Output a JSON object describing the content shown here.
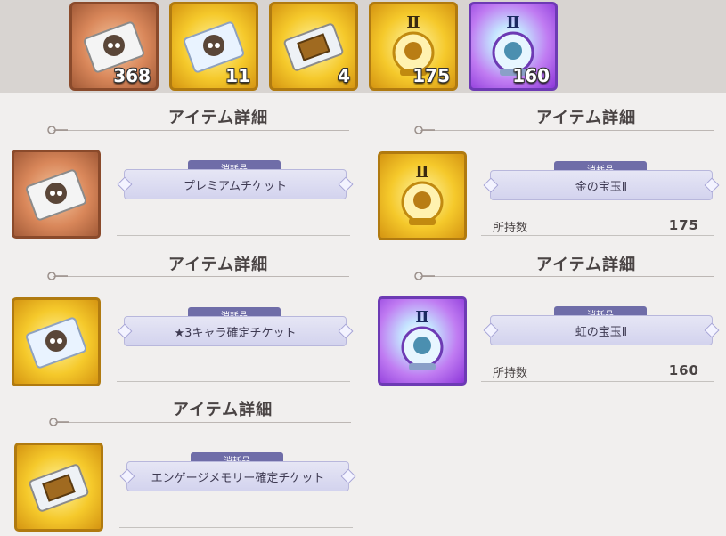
{
  "inventory": [
    {
      "icon": "premium-ticket-icon",
      "count": "368"
    },
    {
      "icon": "star3-ticket-icon",
      "count": "11"
    },
    {
      "icon": "engage-memory-ticket-icon",
      "count": "4"
    },
    {
      "icon": "gold-orb-icon",
      "count": "175"
    },
    {
      "icon": "rainbow-orb-icon",
      "count": "160"
    }
  ],
  "orb_numeral": "Ⅱ",
  "panels": [
    {
      "title": "アイテム詳細",
      "tag": "消耗品",
      "name": "プレミアムチケット",
      "icon": "premium-ticket-icon"
    },
    {
      "title": "アイテム詳細",
      "tag": "消耗品",
      "name": "★3キャラ確定チケット",
      "icon": "star3-ticket-icon"
    },
    {
      "title": "アイテム詳細",
      "tag": "消耗品",
      "name": "エンゲージメモリー確定チケット",
      "icon": "engage-memory-ticket-icon"
    },
    {
      "title": "アイテム詳細",
      "tag": "消耗品",
      "name": "金の宝玉Ⅱ",
      "icon": "gold-orb-icon",
      "owned_label": "所持数",
      "owned_value": "175"
    },
    {
      "title": "アイテム詳細",
      "tag": "消耗品",
      "name": "虹の宝玉Ⅱ",
      "icon": "rainbow-orb-icon",
      "owned_label": "所持数",
      "owned_value": "160"
    }
  ],
  "colors": {
    "bronze": "#d9875a",
    "gold": "#f5c92b",
    "rainbow": "#c07cf2",
    "plate": "#d3d3ee",
    "tag": "#6f6da8"
  }
}
